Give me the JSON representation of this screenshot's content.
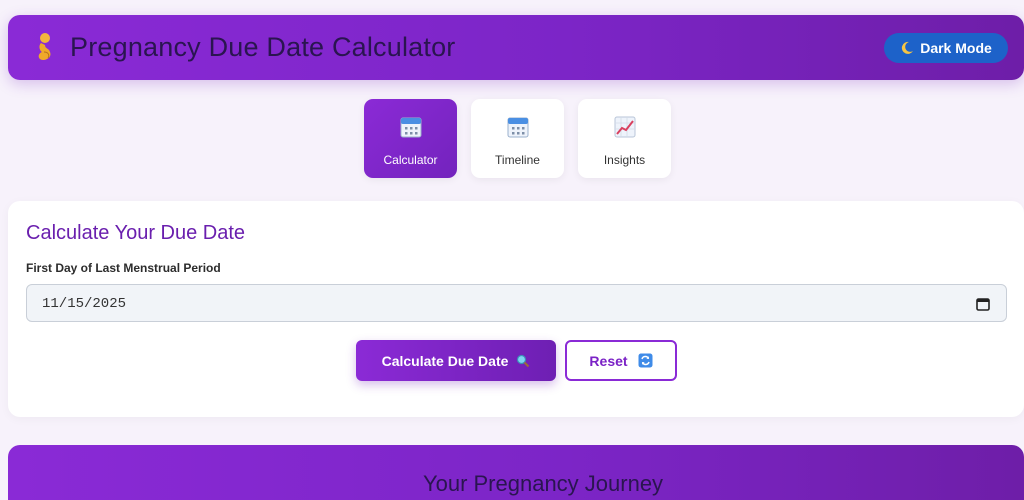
{
  "header": {
    "title": "Pregnancy Due Date Calculator",
    "logo_icon": "pregnant-woman-icon",
    "dark_mode_label": "Dark Mode",
    "dark_mode_icon": "crescent-moon-icon"
  },
  "tabs": [
    {
      "label": "Calculator",
      "icon": "calendar-icon",
      "active": true
    },
    {
      "label": "Timeline",
      "icon": "calendar-icon",
      "active": false
    },
    {
      "label": "Insights",
      "icon": "chart-increasing-icon",
      "active": false
    }
  ],
  "calculator": {
    "title": "Calculate Your Due Date",
    "lmp_label": "First Day of Last Menstrual Period",
    "lmp_value": "11/15/2025",
    "calculate_label": "Calculate Due Date",
    "calculate_icon": "magnifying-glass-icon",
    "reset_label": "Reset",
    "reset_icon": "refresh-icon"
  },
  "journey": {
    "title": "Your Pregnancy Journey"
  },
  "colors": {
    "primary": "#8a2ad6",
    "title_purple": "#6a1fae",
    "dark_mode_blue": "#1d62c9",
    "background": "#f7f2fb"
  }
}
